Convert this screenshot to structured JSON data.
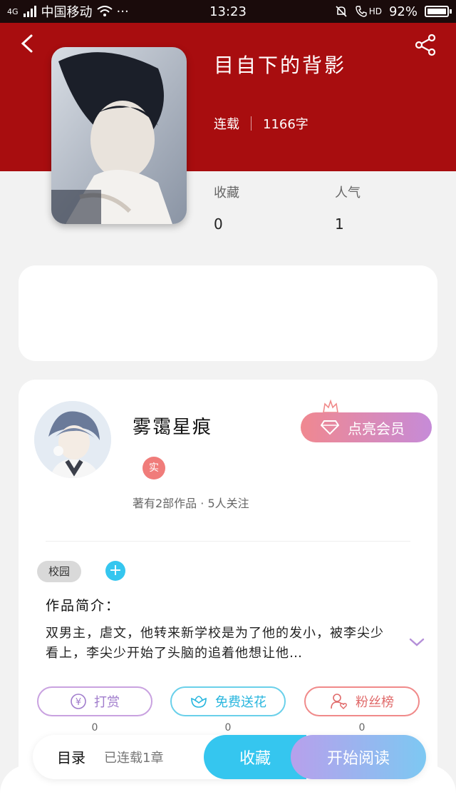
{
  "status_bar": {
    "network": "4G",
    "carrier": "中国移动",
    "more": "···",
    "time": "13:23",
    "hd": "HD",
    "battery": "92%",
    "battery_level": 0.92
  },
  "book": {
    "title": "目自下的背影",
    "status": "连载",
    "word_count": "1166字",
    "favorites_label": "收藏",
    "favorites_value": "0",
    "popularity_label": "人气",
    "popularity_value": "1"
  },
  "author": {
    "name": "雾霭星痕",
    "badge": "实",
    "meta": "著有2部作品 · 5人关注",
    "vip_button": "点亮会员"
  },
  "tags": [
    "校园"
  ],
  "intro": {
    "label": "作品简介：",
    "text": "双男主，虐文，他转来新学校是为了他的发小，被李尖少看上，李尖少开始了头脑的追着他想让他…"
  },
  "actions": [
    {
      "label": "打赏",
      "count": "0",
      "icon": "yen-icon"
    },
    {
      "label": "免费送花",
      "count": "0",
      "icon": "flower-icon"
    },
    {
      "label": "粉丝榜",
      "count": "0",
      "icon": "user-heart-icon"
    }
  ],
  "bottom_bar": {
    "toc_label": "目录",
    "toc_count": "已连载1章",
    "favorite_button": "收藏",
    "read_button": "开始阅读"
  },
  "colors": {
    "header_red": "#a80d0f",
    "favorite_blue": "#35c6ef",
    "read_gradient_start": "#b7a0ec",
    "read_gradient_end": "#7dc8f2"
  }
}
